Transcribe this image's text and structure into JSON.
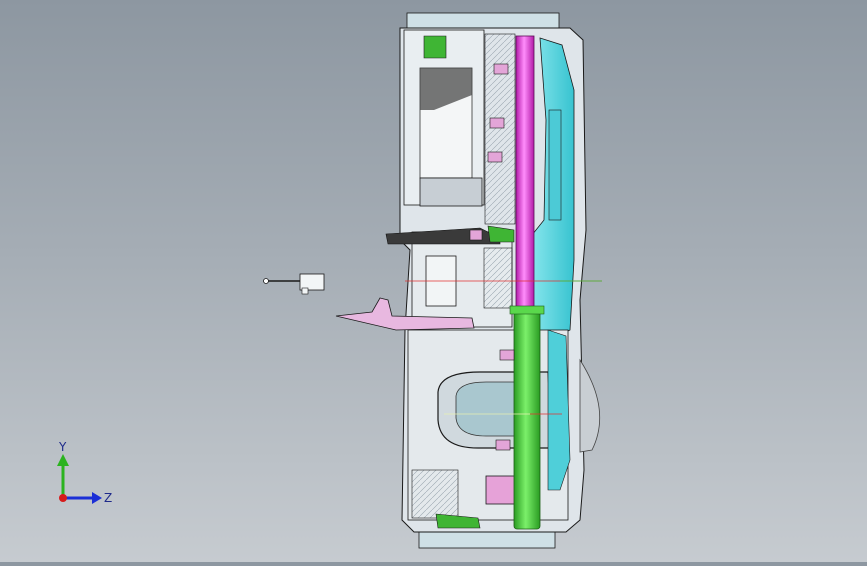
{
  "window": {
    "background": "gradient-gray"
  },
  "triad": {
    "y_label": "Y",
    "z_label": "Z",
    "colors": {
      "y": "#2bb31f",
      "z": "#1b2fd6",
      "x": "#d61b1b"
    }
  },
  "model": {
    "colors": {
      "outline": "#1a1a1a",
      "cyan_panel": "#5fd6e0",
      "green_pipe": "#46d23a",
      "magenta_pipe": "#e43cdf",
      "pink_parts": "#e3a5d8",
      "dark_green": "#2f8f2a",
      "housing": "#d7dee4",
      "dark_block": "#3b3b3b"
    },
    "axes": {
      "red": "#e03030",
      "green": "#39c839"
    }
  }
}
